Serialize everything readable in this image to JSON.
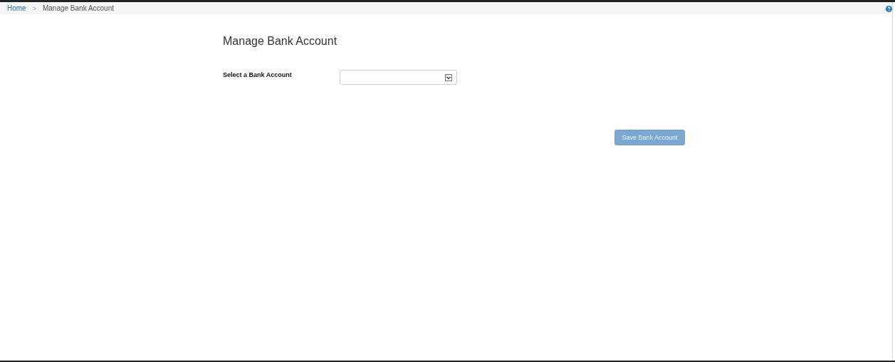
{
  "breadcrumb": [
    {
      "label": "Home",
      "kind": "link"
    },
    {
      "label": ">",
      "kind": "separator"
    },
    {
      "label": "Manage Bank Account",
      "kind": "current"
    }
  ],
  "title": "Manage Bank Account",
  "form": {
    "label": "Select a Bank Account"
  },
  "save_button": {
    "label": "Save Bank Account",
    "disabled": true
  }
}
